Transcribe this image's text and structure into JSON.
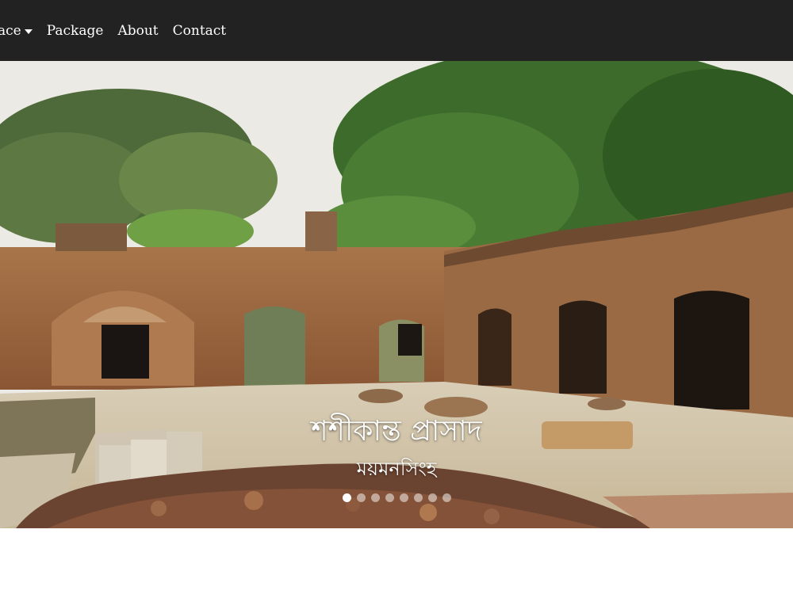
{
  "nav": {
    "items": [
      {
        "label": "ace",
        "dropdown": true
      },
      {
        "label": "Package"
      },
      {
        "label": "About"
      },
      {
        "label": "Contact"
      }
    ]
  },
  "carousel": {
    "caption_title": "শশীকান্ত প্রাসাদ",
    "caption_subtitle": "ময়মনসিংহ",
    "slide_count": 8,
    "active_index": 0
  },
  "colors": {
    "navbar_bg": "#222222",
    "nav_text": "#ffffff"
  }
}
